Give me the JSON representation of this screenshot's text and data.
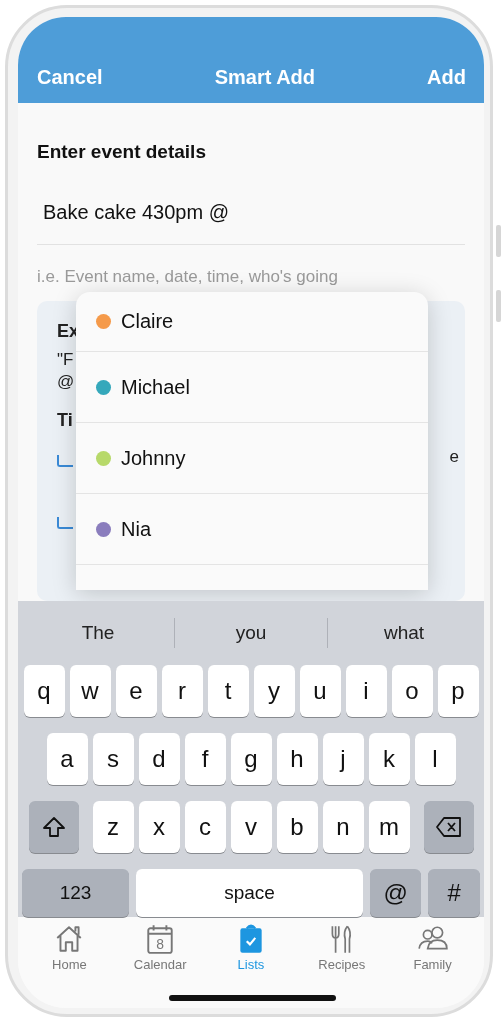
{
  "header": {
    "cancel": "Cancel",
    "title": "Smart Add",
    "add": "Add"
  },
  "form": {
    "heading": "Enter event details",
    "value": "Bake cake 430pm @",
    "hint": "i.e. Event name, date, time, who's going"
  },
  "example_card": {
    "title": "Ex",
    "line_1": "\"F",
    "line_2": "@",
    "subtitle": "Ti",
    "fragment": "e"
  },
  "mentions": [
    {
      "name": "Claire",
      "color": "#f59a4a"
    },
    {
      "name": "Michael",
      "color": "#35a8bb"
    },
    {
      "name": "Johnny",
      "color": "#b7d96a"
    },
    {
      "name": "Nia",
      "color": "#8a7dbd"
    }
  ],
  "keyboard": {
    "suggestions": [
      "The",
      "you",
      "what"
    ],
    "rows": [
      [
        "q",
        "w",
        "e",
        "r",
        "t",
        "y",
        "u",
        "i",
        "o",
        "p"
      ],
      [
        "a",
        "s",
        "d",
        "f",
        "g",
        "h",
        "j",
        "k",
        "l"
      ],
      [
        "z",
        "x",
        "c",
        "v",
        "b",
        "n",
        "m"
      ]
    ],
    "numbers": "123",
    "space": "space",
    "at": "@",
    "hash": "#"
  },
  "tabs": [
    {
      "label": "Home",
      "kind": "home",
      "selected": false
    },
    {
      "label": "Calendar",
      "kind": "calendar",
      "date": "8",
      "selected": false
    },
    {
      "label": "Lists",
      "kind": "clipboard",
      "selected": true
    },
    {
      "label": "Recipes",
      "kind": "cutlery",
      "selected": false
    },
    {
      "label": "Family",
      "kind": "people",
      "selected": false
    }
  ]
}
